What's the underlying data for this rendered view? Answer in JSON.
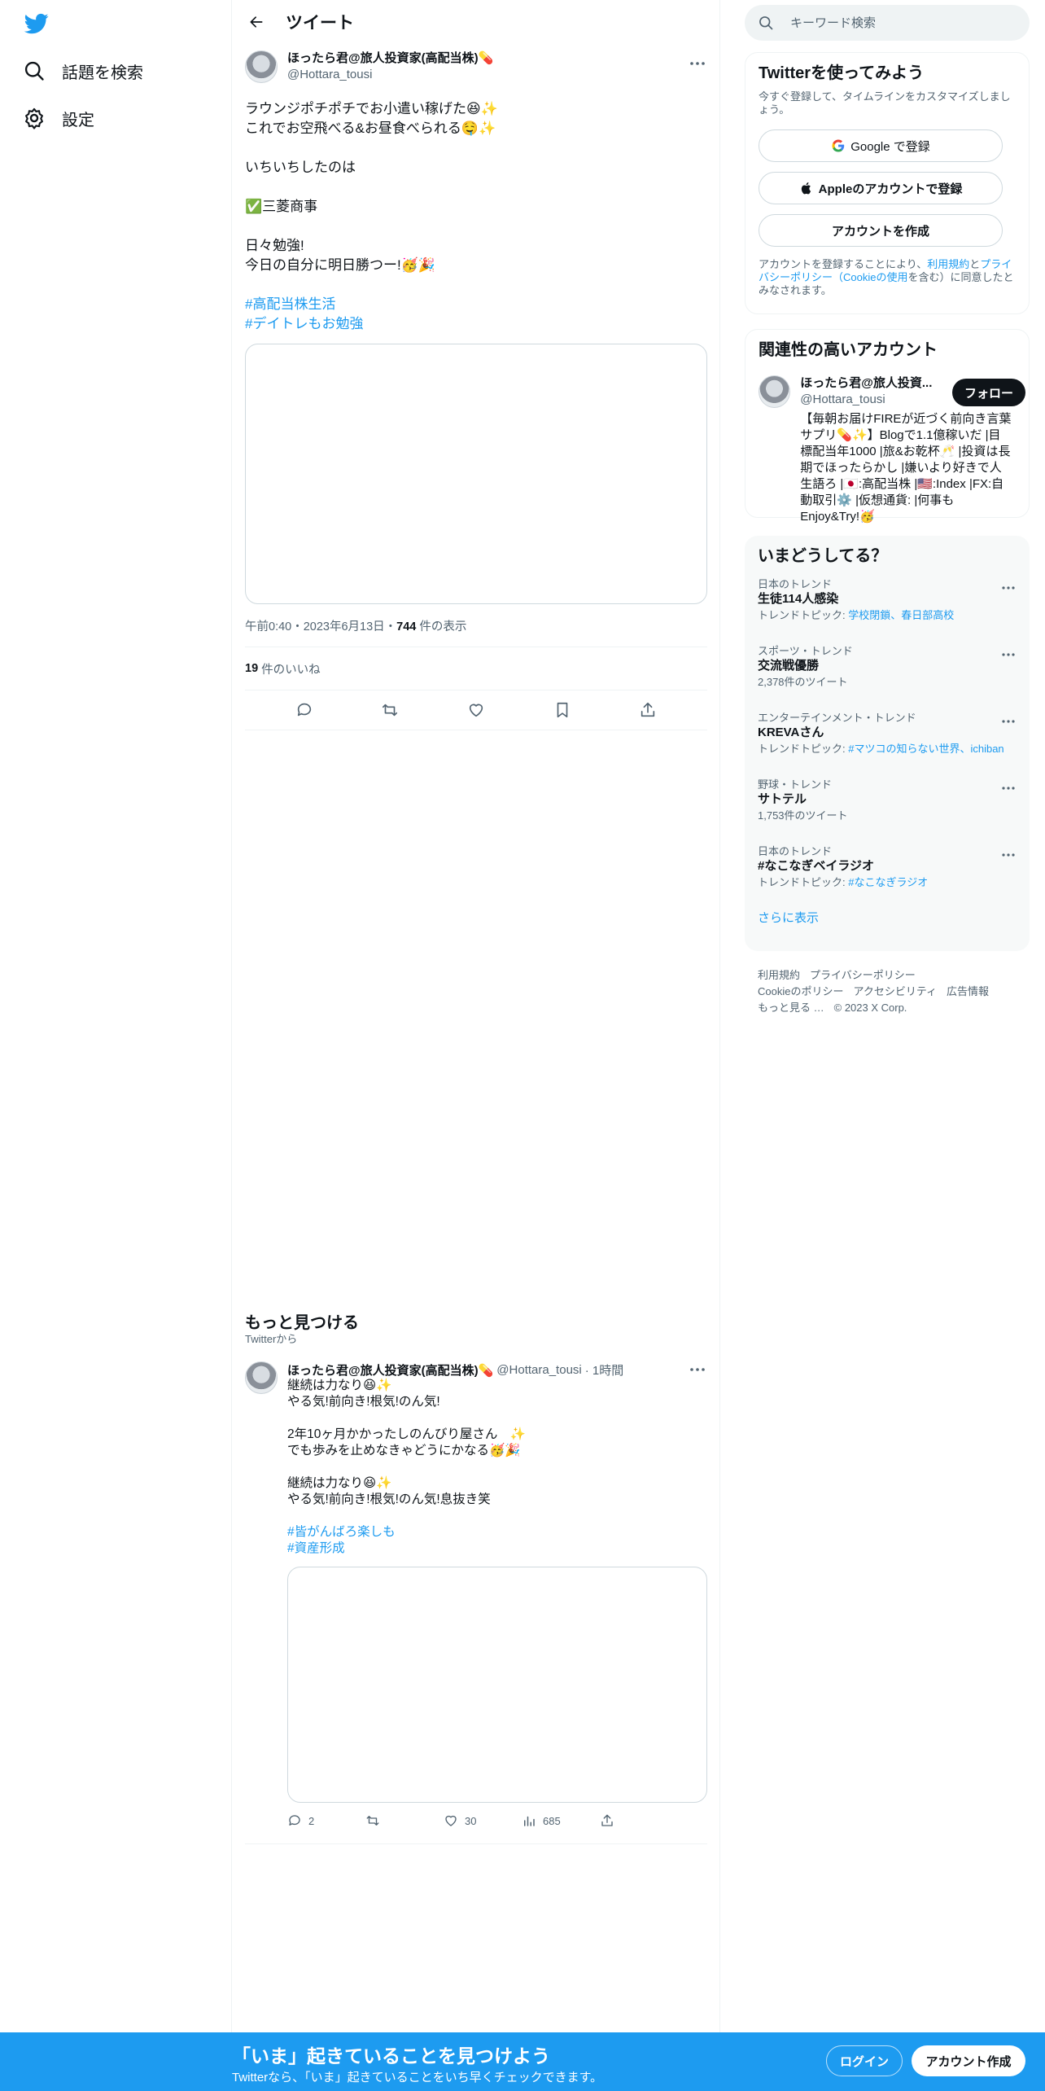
{
  "nav": {
    "explore_label": "話題を検索",
    "settings_label": "設定"
  },
  "header": {
    "title": "ツイート"
  },
  "tweet": {
    "name": "ほったら君@旅人投資家(高配当株)💊",
    "handle": "@Hottara_tousi",
    "body": "ラウンジポチポチでお小遣い稼げた😆✨\nこれでお空飛べる&お昼食べられる🤤✨\n\nいちいちしたのは\n\n✅三菱商事\n\n日々勉強!\n今日の自分に明日勝つー!🥳🎉",
    "hashtags": [
      "#高配当株生活",
      "#デイトレもお勉強"
    ],
    "time": "午前0:40・2023年6月13日・",
    "views": "744",
    "views_label": "件の表示",
    "likes": "19",
    "likes_label": "件のいいね"
  },
  "discover": {
    "title": "もっと見つける",
    "subtitle": "Twitterから"
  },
  "related_tweet": {
    "name": "ほったら君@旅人投資家(高配当株)💊",
    "handle": "@Hottara_tousi",
    "time": "· 1時間",
    "body": "継続は力なり😆✨\nやる気!前向き!根気!のん気!\n\n2年10ヶ月かかったしのんびり屋さん　✨\nでも歩みを止めなきゃどうにかなる🥳🎉\n\n継続は力なり😆✨\nやる気!前向き!根気!のん気!息抜き笑",
    "hashtags": [
      "#皆がんばろ楽しも",
      "#資産形成"
    ],
    "replies": "2",
    "likes": "30",
    "views": "685"
  },
  "search": {
    "placeholder": "キーワード検索"
  },
  "signup": {
    "title": "Twitterを使ってみよう",
    "desc": "今すぐ登録して、タイムラインをカスタマイズしましょう。",
    "google_label": "Google で登録",
    "apple_label": "Appleのアカウントで登録",
    "create_label": "アカウントを作成",
    "terms_pre": "アカウントを登録することにより、",
    "terms_link1": "利用規約",
    "terms_mid": "と",
    "terms_link2": "プライバシーポリシー（Cookieの使用",
    "terms_post": "を含む）に同意したとみなされます。"
  },
  "related": {
    "title": "関連性の高いアカウント",
    "name": "ほったら君@旅人投資...",
    "handle": "@Hottara_tousi",
    "follow_label": "フォロー",
    "bio": "【毎朝お届けFIREが近づく前向き言葉サプリ💊✨】Blogで1.1億稼いだ |目標配当年1000 |旅&お乾杯🥂 |投資は長期でほったらかし |嫌いより好きで人生語ろ |🇯🇵:高配当株 |🇺🇸:Index |FX:自動取引⚙️ |仮想通貨: |何事もEnjoy&Try!🥳"
  },
  "trends": {
    "title": "いまどうしてる？",
    "items": [
      {
        "category": "日本のトレンド",
        "name": "生徒114人感染",
        "sub_pre": "トレンドトピック: ",
        "sub_link": "学校閉鎖、春日部高校"
      },
      {
        "category": "スポーツ・トレンド",
        "name": "交流戦優勝",
        "sub_pre": "2,378件のツイート",
        "sub_link": ""
      },
      {
        "category": "エンターテインメント・トレンド",
        "name": "KREVAさん",
        "sub_pre": "トレンドトピック: ",
        "sub_link": "#マツコの知らない世界、ichiban"
      },
      {
        "category": "野球・トレンド",
        "name": "サトテル",
        "sub_pre": "1,753件のツイート",
        "sub_link": ""
      },
      {
        "category": "日本のトレンド",
        "name": "#なこなぎベイラジオ",
        "sub_pre": "トレンドトピック: ",
        "sub_link": "#なこなぎラジオ"
      }
    ],
    "show_more": "さらに表示"
  },
  "footer": {
    "links": [
      "利用規約",
      "プライバシーポリシー",
      "Cookieのポリシー",
      "アクセシビリティ",
      "広告情報",
      "もっと見る …",
      "© 2023 X Corp."
    ]
  },
  "bottombar": {
    "title": "「いま」起きていることを見つけよう",
    "subtitle": "Twitterなら、「いま」起きていることをいち早くチェックできます。",
    "login_label": "ログイン",
    "signup_label": "アカウント作成"
  },
  "colors": {
    "accent": "#1d9bf0",
    "text": "#0f1419",
    "muted": "#536471"
  }
}
